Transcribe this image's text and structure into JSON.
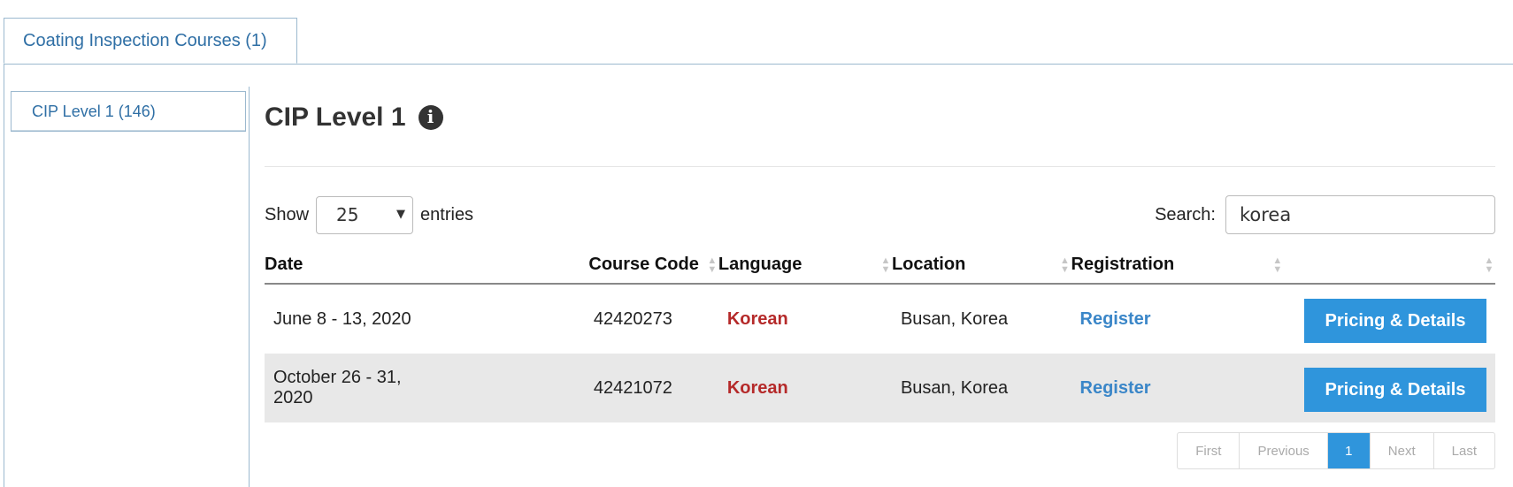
{
  "tabs": [
    {
      "label": "Coating Inspection Courses (1)"
    }
  ],
  "sidebar": {
    "items": [
      {
        "label": "CIP Level 1 (146)"
      }
    ]
  },
  "main": {
    "title": "CIP Level 1",
    "info_icon": "info-circle-icon"
  },
  "length_control": {
    "prefix": "Show",
    "value": "25",
    "suffix": "entries"
  },
  "search": {
    "label": "Search:",
    "value": "korea"
  },
  "table": {
    "columns": [
      "Date",
      "Course Code",
      "Language",
      "Location",
      "Registration",
      ""
    ],
    "rows": [
      {
        "date": "June 8 - 13, 2020",
        "code": "42420273",
        "language": "Korean",
        "location": "Busan, Korea",
        "register": "Register",
        "action": "Pricing & Details"
      },
      {
        "date": "October 26 - 31, 2020",
        "code": "42421072",
        "language": "Korean",
        "location": "Busan, Korea",
        "register": "Register",
        "action": "Pricing & Details"
      }
    ]
  },
  "pagination": {
    "first": "First",
    "previous": "Previous",
    "current": "1",
    "next": "Next",
    "last": "Last"
  },
  "colors": {
    "accent": "#2f95dc",
    "language": "#b52a2a",
    "link": "#3a86c8",
    "tab_text": "#2f6fa5"
  }
}
